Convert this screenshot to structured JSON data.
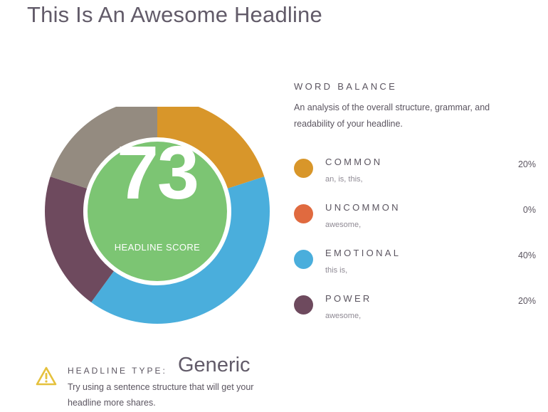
{
  "headline": "This Is An Awesome Headline",
  "score": {
    "value": "73",
    "label": "HEADLINE SCORE",
    "color": "#7cc573"
  },
  "word_balance": {
    "title": "WORD BALANCE",
    "description": "An analysis of the overall structure, grammar, and readability of your headline.",
    "categories": [
      {
        "name": "COMMON",
        "examples": "an, is, this,",
        "percent": "20%",
        "value": 20,
        "color": "#d8962a"
      },
      {
        "name": "UNCOMMON",
        "examples": "awesome,",
        "percent": "0%",
        "value": 0,
        "color": "#e06a3f"
      },
      {
        "name": "EMOTIONAL",
        "examples": "this is,",
        "percent": "40%",
        "value": 40,
        "color": "#4aaedc"
      },
      {
        "name": "POWER",
        "examples": "awesome,",
        "percent": "20%",
        "value": 20,
        "color": "#6e4a5e"
      }
    ],
    "remainder_color": "#948b80"
  },
  "headline_type": {
    "label": "HEADLINE TYPE:",
    "value": "Generic",
    "tip": "Try using a sentence structure that will get your headline more shares.",
    "warning_color": "#e5c13d"
  }
}
